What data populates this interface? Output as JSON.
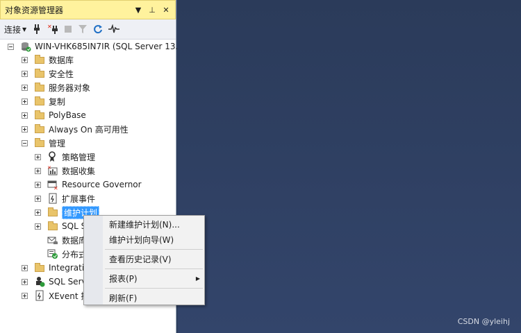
{
  "panel": {
    "title": "对象资源管理器",
    "controls": [
      "▼",
      "⊥",
      "✕"
    ]
  },
  "toolbar": {
    "connect_label": "连接",
    "buttons": [
      "connect-icon",
      "disconnect-icon",
      "stop-icon",
      "filter-icon",
      "refresh-icon",
      "activity-icon"
    ]
  },
  "tree": {
    "server": "WIN-VHK685IN7IR (SQL Server 13.",
    "items": [
      {
        "label": "数据库",
        "icon": "folder-icon",
        "expand": "plus"
      },
      {
        "label": "安全性",
        "icon": "folder-icon",
        "expand": "plus"
      },
      {
        "label": "服务器对象",
        "icon": "folder-icon",
        "expand": "plus"
      },
      {
        "label": "复制",
        "icon": "folder-icon",
        "expand": "plus"
      },
      {
        "label": "PolyBase",
        "icon": "folder-icon",
        "expand": "plus"
      },
      {
        "label": "Always On 高可用性",
        "icon": "folder-icon",
        "expand": "plus"
      },
      {
        "label": "管理",
        "icon": "folder-icon",
        "expand": "minus"
      },
      {
        "label": "策略管理",
        "icon": "policy-icon",
        "expand": "plus"
      },
      {
        "label": "数据收集",
        "icon": "data-collection-icon",
        "expand": "plus"
      },
      {
        "label": "Resource Governor",
        "icon": "resource-governor-icon",
        "expand": "plus"
      },
      {
        "label": "扩展事件",
        "icon": "extended-events-icon",
        "expand": "plus"
      },
      {
        "label": "维护计划",
        "icon": "folder-icon",
        "expand": "plus"
      },
      {
        "label": "SQL S",
        "icon": "folder-icon",
        "expand": "plus"
      },
      {
        "label": "数据库",
        "icon": "db-mail-icon",
        "expand": "none"
      },
      {
        "label": "分布式",
        "icon": "dtc-icon",
        "expand": "none"
      },
      {
        "label": "Integration",
        "icon": "folder-icon",
        "expand": "plus"
      },
      {
        "label": "SQL Serv",
        "icon": "agent-icon",
        "expand": "plus"
      },
      {
        "label": "XEvent 探",
        "icon": "xevent-icon",
        "expand": "plus"
      }
    ]
  },
  "context_menu": {
    "items": [
      {
        "label": "新建维护计划(N)..."
      },
      {
        "label": "维护计划向导(W)"
      },
      {
        "label": "查看历史记录(V)"
      },
      {
        "label": "报表(P)",
        "submenu_arrow": "▶"
      },
      {
        "label": "刷新(F)"
      }
    ]
  },
  "watermark": "CSDN @yleihj",
  "colors": {
    "title_bar": "#fff29d",
    "selection": "#3399ff",
    "desktop": "#2f3f5e"
  }
}
